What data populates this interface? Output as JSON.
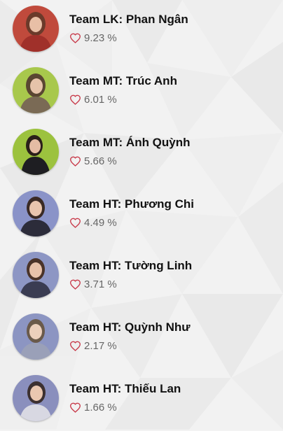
{
  "contestants": [
    {
      "name": "Team LK: Phan Ngân",
      "percent": "9.23 %",
      "avatar_bg": "#c04a3c",
      "avatar_icon": "person-photo-icon"
    },
    {
      "name": "Team MT: Trúc Anh",
      "percent": "6.01 %",
      "avatar_bg": "#a8c84c",
      "avatar_icon": "person-photo-icon"
    },
    {
      "name": "Team MT: Ánh Quỳnh",
      "percent": "5.66 %",
      "avatar_bg": "#9cc23e",
      "avatar_icon": "person-photo-icon"
    },
    {
      "name": "Team HT: Phương Chi",
      "percent": "4.49 %",
      "avatar_bg": "#8a93c8",
      "avatar_icon": "person-photo-icon"
    },
    {
      "name": "Team HT: Tường Linh",
      "percent": "3.71 %",
      "avatar_bg": "#8d96c4",
      "avatar_icon": "person-photo-icon"
    },
    {
      "name": "Team HT: Quỳnh Như",
      "percent": "2.17 %",
      "avatar_bg": "#8c95c2",
      "avatar_icon": "person-photo-icon"
    },
    {
      "name": "Team HT: Thiếu Lan",
      "percent": "1.66 %",
      "avatar_bg": "#8a8fbd",
      "avatar_icon": "person-photo-icon"
    }
  ],
  "icons": {
    "vote": "heart-outline-icon"
  },
  "colors": {
    "heart": "#c83a4a",
    "name_text": "#111111",
    "percent_text": "#666666"
  }
}
